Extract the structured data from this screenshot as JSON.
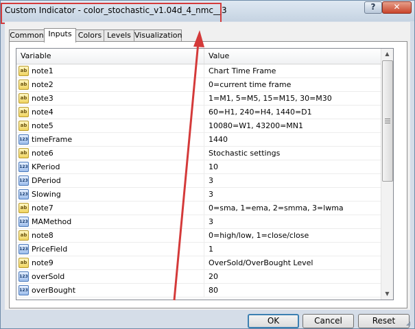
{
  "window": {
    "title": "Custom Indicator - color_stochastic_v1.04d_4_nmc__3",
    "help_label": "?",
    "close_label": "✕"
  },
  "tabs": [
    {
      "label": "Common"
    },
    {
      "label": "Inputs"
    },
    {
      "label": "Colors"
    },
    {
      "label": "Levels"
    },
    {
      "label": "Visualization"
    }
  ],
  "active_tab": "Inputs",
  "grid": {
    "col_variable": "Variable",
    "col_value": "Value",
    "rows": [
      {
        "type": "ab",
        "icon_text": "ab",
        "name": "note1",
        "value": "Chart Time Frame"
      },
      {
        "type": "ab",
        "icon_text": "ab",
        "name": "note2",
        "value": "0=current time frame"
      },
      {
        "type": "ab",
        "icon_text": "ab",
        "name": "note3",
        "value": "1=M1, 5=M5, 15=M15, 30=M30"
      },
      {
        "type": "ab",
        "icon_text": "ab",
        "name": "note4",
        "value": "60=H1, 240=H4, 1440=D1"
      },
      {
        "type": "ab",
        "icon_text": "ab",
        "name": "note5",
        "value": "10080=W1, 43200=MN1"
      },
      {
        "type": "num",
        "icon_text": "123",
        "name": "timeFrame",
        "value": "1440"
      },
      {
        "type": "ab",
        "icon_text": "ab",
        "name": "note6",
        "value": "Stochastic settings"
      },
      {
        "type": "num",
        "icon_text": "123",
        "name": "KPeriod",
        "value": "10"
      },
      {
        "type": "num",
        "icon_text": "123",
        "name": "DPeriod",
        "value": "3"
      },
      {
        "type": "num",
        "icon_text": "123",
        "name": "Slowing",
        "value": "3"
      },
      {
        "type": "ab",
        "icon_text": "ab",
        "name": "note7",
        "value": "0=sma, 1=ema, 2=smma, 3=lwma"
      },
      {
        "type": "num",
        "icon_text": "123",
        "name": "MAMethod",
        "value": "3"
      },
      {
        "type": "ab",
        "icon_text": "ab",
        "name": "note8",
        "value": "0=high/low, 1=close/close"
      },
      {
        "type": "num",
        "icon_text": "123",
        "name": "PriceField",
        "value": "1"
      },
      {
        "type": "ab",
        "icon_text": "ab",
        "name": "note9",
        "value": "OverSold/OverBought Level"
      },
      {
        "type": "num",
        "icon_text": "123",
        "name": "overSold",
        "value": "20"
      },
      {
        "type": "num",
        "icon_text": "123",
        "name": "overBought",
        "value": "80"
      }
    ]
  },
  "buttons": {
    "ok": "OK",
    "cancel": "Cancel",
    "reset": "Reset"
  },
  "annotation_color": "#d43a3a"
}
